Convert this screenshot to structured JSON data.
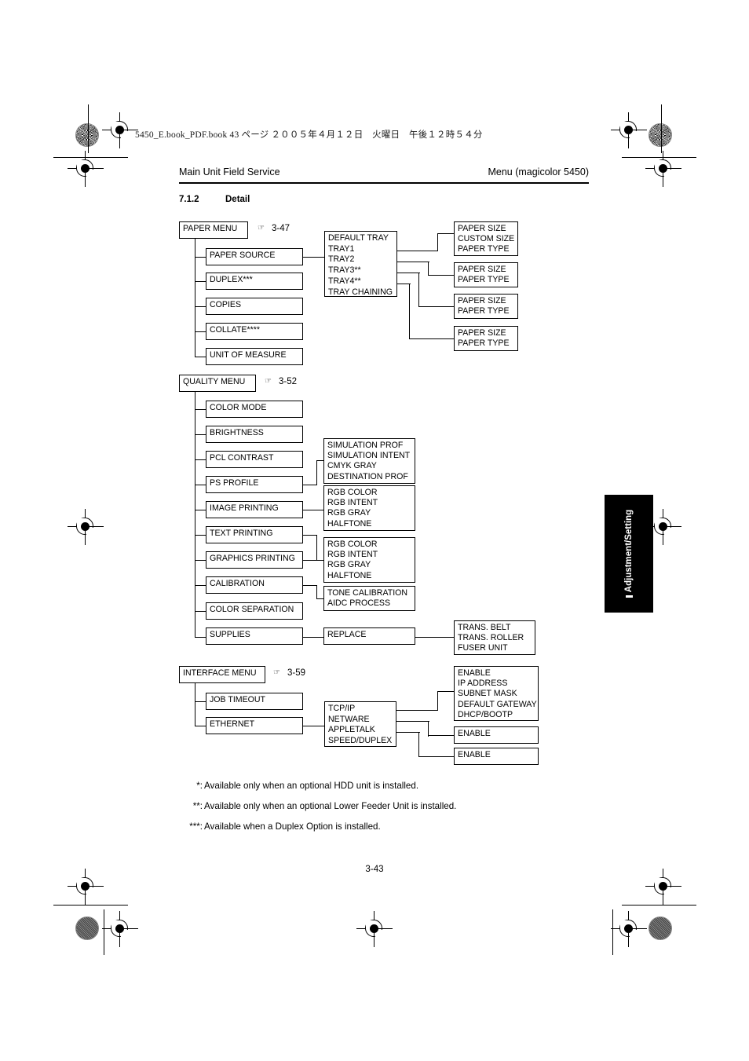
{
  "page": {
    "file_stamp": "5450_E.book_PDF.book  43 ページ  ２００５年４月１２日　火曜日　午後１２時５４分",
    "folio": "3-43",
    "side_tab": "Adjustment/Setting"
  },
  "header": {
    "left": "Main Unit Field Service",
    "right": "Menu (magicolor 5450)"
  },
  "section": {
    "number": "7.1.2",
    "title": "Detail"
  },
  "icons": {
    "hand": "☞"
  },
  "paper_menu": {
    "root": "PAPER MENU",
    "page_ref": "3-47",
    "items": [
      "PAPER SOURCE",
      "DUPLEX***",
      "COPIES",
      "COLLATE****",
      "UNIT OF MEASURE"
    ],
    "source_group": "DEFAULT TRAY\nTRAY1\nTRAY2\nTRAY3**\nTRAY4**\nTRAY CHAINING",
    "tray1_detail": "PAPER SIZE\nCUSTOM SIZE\nPAPER TYPE",
    "tray2_detail": "PAPER SIZE\nPAPER TYPE",
    "tray3_detail": "PAPER SIZE\nPAPER TYPE",
    "tray4_detail": "PAPER SIZE\nPAPER TYPE"
  },
  "quality_menu": {
    "root": "QUALITY MENU",
    "page_ref": "3-52",
    "items": [
      "COLOR MODE",
      "BRIGHTNESS",
      "PCL CONTRAST",
      "PS PROFILE",
      "IMAGE PRINTING",
      "TEXT PRINTING",
      "GRAPHICS PRINTING",
      "CALIBRATION",
      "COLOR SEPARATION",
      "SUPPLIES"
    ],
    "ps_profile_detail": "SIMULATION PROF\nSIMULATION INTENT\nCMYK GRAY\nDESTINATION PROF",
    "image_printing_detail": "RGB COLOR\nRGB INTENT\nRGB GRAY\nHALFTONE",
    "text_graphics_detail": "RGB COLOR\nRGB INTENT\nRGB GRAY\nHALFTONE",
    "calibration_detail": "TONE CALIBRATION\nAIDC PROCESS",
    "supplies_detail": "REPLACE",
    "replace_detail": "TRANS. BELT\nTRANS. ROLLER\nFUSER UNIT"
  },
  "interface_menu": {
    "root": "INTERFACE MENU",
    "page_ref": "3-59",
    "items": [
      "JOB TIMEOUT",
      "ETHERNET"
    ],
    "ethernet_group": "TCP/IP\nNETWARE\nAPPLETALK\nSPEED/DUPLEX",
    "tcpip_detail": "ENABLE\nIP ADDRESS\nSUBNET MASK\nDEFAULT GATEWAY\nDHCP/BOOTP",
    "netware_detail": "ENABLE",
    "appletalk_detail": "ENABLE"
  },
  "footnotes": [
    {
      "mark": "*:",
      "text": "Available only when an optional HDD unit is installed."
    },
    {
      "mark": "**:",
      "text": "Available only when an optional Lower Feeder Unit is installed."
    },
    {
      "mark": "***:",
      "text": "Available when a Duplex Option is installed."
    }
  ]
}
